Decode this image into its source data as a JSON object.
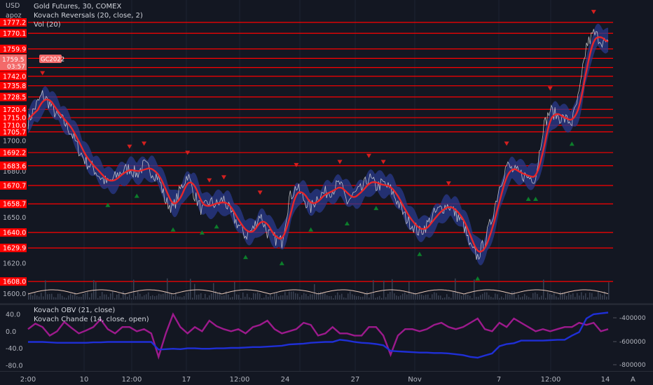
{
  "header": {
    "currency": "USD",
    "user": "apoz",
    "symbol_line": "Gold Futures, 30, COMEX",
    "indicator1": "Kovach Reversals (20, close, 2)",
    "indicator2": "Vol (20)"
  },
  "lower_pane": {
    "indicator1": "Kovach OBV (21, close)",
    "indicator2": "Kovach Chande (14, close, open)"
  },
  "badge": {
    "price": "1759.5",
    "countdown": "03:57",
    "contract": "GC2022"
  },
  "x_labels": [
    "2:00",
    "10",
    "12:00",
    "17",
    "12:00",
    "24",
    "27",
    "Nov",
    "7",
    "12:00",
    "14"
  ],
  "footer": {
    "auto": "A"
  },
  "colors": {
    "background": "#131722",
    "level_line": "#ff0000",
    "price_line": "#d8d8d8",
    "ma": "#e8262a",
    "band": "#2a3a8c",
    "up_arrow": "#0c7d2b",
    "down_arrow": "#d5201f",
    "obv": "#1f2fd6",
    "chande": "#9c1a8c"
  },
  "chart_data": [
    {
      "type": "line",
      "title": "Gold Futures, 30, COMEX",
      "ylim": [
        1598,
        1790
      ],
      "y_ticks": [
        "1700.0",
        "1680.0",
        "1650.0",
        "1620.0",
        "1600.0"
      ],
      "levels": [
        "1777.2",
        "1770.1",
        "1759.9",
        "1753.7",
        "1747.7",
        "1742.0",
        "1735.8",
        "1728.5",
        "1720.4",
        "1715.0",
        "1710.0",
        "1705.7",
        "1692.2",
        "1683.6",
        "1670.7",
        "1658.7",
        "1640.0",
        "1629.9",
        "1608.0"
      ],
      "series": [
        {
          "values": [
            1712,
            1722,
            1730,
            1724,
            1716,
            1712,
            1705,
            1694,
            1686,
            1682,
            1676,
            1672,
            1676,
            1680,
            1682,
            1678,
            1684,
            1680,
            1676,
            1660,
            1656,
            1668,
            1678,
            1664,
            1654,
            1660,
            1658,
            1662,
            1652,
            1645,
            1638,
            1642,
            1652,
            1640,
            1636,
            1634,
            1662,
            1670,
            1662,
            1656,
            1664,
            1666,
            1668,
            1672,
            1660,
            1665,
            1668,
            1676,
            1670,
            1672,
            1668,
            1660,
            1650,
            1645,
            1640,
            1645,
            1652,
            1656,
            1658,
            1652,
            1646,
            1630,
            1624,
            1634,
            1650,
            1670,
            1684,
            1680,
            1678,
            1676,
            1676,
            1708,
            1720,
            1716,
            1714,
            1712,
            1730,
            1762,
            1770,
            1766,
            1762
          ]
        }
      ]
    },
    {
      "type": "line",
      "title": "Kovach OBV (21, close) / Kovach Chande (14, close, open)",
      "ylim": [
        -90,
        58
      ],
      "y_ticks": [
        "40.0",
        "0.0",
        "-40.0",
        "-80.0"
      ],
      "y2_ticks": [
        "-400000",
        "-600000",
        "-800000"
      ],
      "series": [
        {
          "values": [
            5,
            18,
            10,
            -10,
            0,
            22,
            8,
            -5,
            2,
            10,
            28,
            5,
            -5,
            10,
            10,
            0,
            5,
            -5,
            -60,
            -5,
            40,
            10,
            -5,
            10,
            0,
            25,
            12,
            5,
            0,
            5,
            -5,
            10,
            15,
            25,
            5,
            -5,
            0,
            5,
            20,
            15,
            -10,
            -5,
            10,
            -5,
            -5,
            -10,
            -10,
            10,
            10,
            -10,
            -55,
            -10,
            5,
            5,
            0,
            5,
            15,
            20,
            10,
            5,
            10,
            20,
            30,
            5,
            0,
            20,
            10,
            30,
            20,
            10,
            0,
            5,
            0,
            5,
            10,
            10,
            20,
            15,
            20,
            0,
            5
          ]
        },
        {
          "values": [
            -25,
            -25,
            -25,
            -26,
            -27,
            -27,
            -27,
            -27,
            -27,
            -26,
            -26,
            -25,
            -25,
            -25,
            -25,
            -25,
            -25,
            -25,
            -43,
            -42,
            -41,
            -42,
            -40,
            -40,
            -41,
            -41,
            -40,
            -40,
            -39,
            -39,
            -38,
            -37,
            -37,
            -36,
            -35,
            -34,
            -31,
            -30,
            -29,
            -27,
            -26,
            -25,
            -25,
            -20,
            -22,
            -25,
            -27,
            -28,
            -30,
            -33,
            -46,
            -47,
            -48,
            -49,
            -50,
            -50,
            -51,
            -51,
            -52,
            -54,
            -56,
            -60,
            -62,
            -57,
            -52,
            -35,
            -30,
            -28,
            -22,
            -22,
            -22,
            -22,
            -21,
            -20,
            -20,
            -10,
            -2,
            30,
            40,
            42,
            44
          ]
        }
      ]
    }
  ]
}
